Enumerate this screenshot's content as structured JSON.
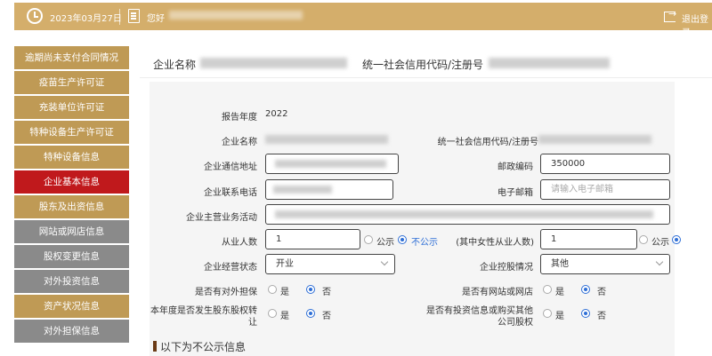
{
  "header": {
    "date": "2023年03月27日",
    "greeting": "您好",
    "logout_label": "退出登录",
    "accent_color": "#d4ae6b"
  },
  "sidebar": {
    "items": [
      {
        "label": "逾期尚未支付合同情况",
        "state": "normal"
      },
      {
        "label": "疫苗生产许可证",
        "state": "normal"
      },
      {
        "label": "充装单位许可证",
        "state": "normal"
      },
      {
        "label": "特种设备生产许可证",
        "state": "normal"
      },
      {
        "label": "特种设备信息",
        "state": "normal"
      },
      {
        "label": "企业基本信息",
        "state": "active"
      },
      {
        "label": "股东及出资信息",
        "state": "normal"
      },
      {
        "label": "网站或网店信息",
        "state": "grey"
      },
      {
        "label": "股权变更信息",
        "state": "grey"
      },
      {
        "label": "对外投资信息",
        "state": "grey"
      },
      {
        "label": "资产状况信息",
        "state": "normal"
      },
      {
        "label": "对外担保信息",
        "state": "grey"
      }
    ],
    "colors": {
      "normal": "#bf9a55",
      "active": "#c0191c",
      "grey": "#8a8a8a"
    }
  },
  "main": {
    "head": {
      "company_name_label": "企业名称",
      "credit_code_label": "统一社会信用代码/注册号"
    },
    "form": {
      "report_year_label": "报告年度",
      "report_year_value": "2022",
      "company_name_label": "企业名称",
      "credit_code_label": "统一社会信用代码/注册号",
      "address_label": "企业通信地址",
      "postcode_label": "邮政编码",
      "postcode_value": "350000",
      "phone_label": "企业联系电话",
      "email_label": "电子邮箱",
      "email_placeholder": "请输入电子邮箱",
      "business_label": "企业主营业务活动",
      "employees_label": "从业人数",
      "employees_value": "1",
      "public_label": "公示",
      "not_public_label": "不公示",
      "female_label": "(其中女性从业人数)",
      "female_value": "1",
      "female_public_label": "公示",
      "female_not_public_label": "不公示",
      "status_label": "企业经营状态",
      "status_value": "开业",
      "control_label": "企业控股情况",
      "control_value": "其他",
      "guarantee_label": "是否有对外担保",
      "website_label": "是否有网站或网店",
      "equity_transfer_label_1": "本年度是否发生股东股权转",
      "equity_transfer_label_2": "让",
      "investment_label_1": "是否有投资信息或购买其他",
      "investment_label_2": "公司股权",
      "yes_label": "是",
      "no_label": "否",
      "radio_color": "#2f6fd6"
    },
    "section_title": "以下为不公示信息"
  }
}
